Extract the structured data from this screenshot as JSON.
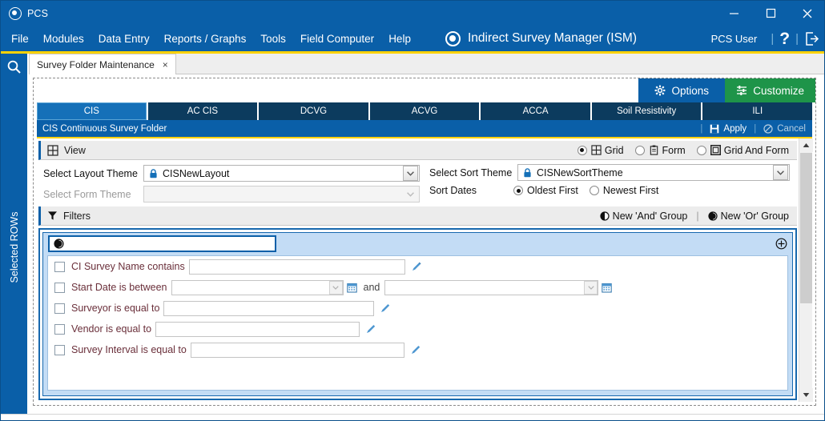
{
  "window": {
    "app_name": "PCS",
    "logo_icon": "pcs-circle-logo",
    "minimize_icon": "minimize-icon",
    "maximize_icon": "maximize-icon",
    "close_icon": "close-icon"
  },
  "menubar": {
    "items": [
      {
        "label": "File"
      },
      {
        "label": "Modules"
      },
      {
        "label": "Data Entry"
      },
      {
        "label": "Reports / Graphs"
      },
      {
        "label": "Tools"
      },
      {
        "label": "Field Computer"
      },
      {
        "label": "Help"
      }
    ],
    "module_title": "Indirect Survey Manager (ISM)",
    "module_icon": "ism-circle-icon",
    "user": "PCS User",
    "help_icon": "question-mark-icon",
    "logout_icon": "logout-icon",
    "separator": "|"
  },
  "doc_tabs": {
    "search_icon": "search-icon",
    "tabs": [
      {
        "label": "Survey Folder Maintenance",
        "close": "×",
        "active": true
      }
    ]
  },
  "sidebar": {
    "vertical_label": "Selected ROWs",
    "grip_icon": "drag-grip-icon"
  },
  "toolbar": {
    "options_label": "Options",
    "options_icon": "gear-icon",
    "customize_label": "Customize",
    "customize_icon": "sliders-icon"
  },
  "category_tabs": [
    {
      "label": "CIS",
      "active": true
    },
    {
      "label": "AC CIS",
      "active": false
    },
    {
      "label": "DCVG",
      "active": false
    },
    {
      "label": "ACVG",
      "active": false
    },
    {
      "label": "ACCA",
      "active": false
    },
    {
      "label": "Soil Resistivity",
      "active": false
    },
    {
      "label": "ILI",
      "active": false
    }
  ],
  "subbar": {
    "title": "CIS Continuous Survey Folder",
    "apply_label": "Apply",
    "apply_icon": "save-disk-icon",
    "cancel_label": "Cancel",
    "cancel_icon": "no-entry-icon",
    "separator": "|"
  },
  "view_section": {
    "title": "View",
    "icon": "grid-icon",
    "modes": [
      {
        "label": "Grid",
        "icon": "grid-icon",
        "selected": true
      },
      {
        "label": "Form",
        "icon": "clipboard-icon",
        "selected": false
      },
      {
        "label": "Grid And Form",
        "icon": "grid-and-form-icon",
        "selected": false
      }
    ]
  },
  "themes": {
    "layout_theme_label": "Select Layout Theme",
    "layout_theme_value": "CISNewLayout",
    "layout_theme_lock_icon": "lock-icon",
    "form_theme_label": "Select Form Theme",
    "form_theme_value": "",
    "sort_theme_label": "Select Sort Theme",
    "sort_theme_value": "CISNewSortTheme",
    "sort_theme_lock_icon": "lock-icon",
    "sort_dates_label": "Sort Dates",
    "sort_dates_options": [
      {
        "label": "Oldest First",
        "selected": true
      },
      {
        "label": "Newest First",
        "selected": false
      }
    ],
    "dropdown_icon": "chevron-down-icon"
  },
  "filters": {
    "title": "Filters",
    "icon": "funnel-icon",
    "new_and_group_label": "New 'And' Group",
    "new_and_group_icon": "half-circle-icon",
    "new_or_group_label": "New 'Or' Group",
    "new_or_group_icon": "half-circle-filled-icon",
    "separator": "|",
    "group": {
      "operator_value": "",
      "operator_icon": "half-circle-icon",
      "add_icon": "plus-circle-icon"
    },
    "conditions": [
      {
        "label": "CI Survey Name contains",
        "value": "",
        "checked": false,
        "type": "text",
        "edit_icon": "pencil-icon"
      },
      {
        "label": "Start Date is between",
        "value": "",
        "value2": "",
        "checked": false,
        "type": "daterange",
        "and_label": "and",
        "dropdown_icon": "chevron-down-icon",
        "calendar_icon": "calendar-icon"
      },
      {
        "label": "Surveyor is equal to",
        "value": "",
        "checked": false,
        "type": "text",
        "edit_icon": "pencil-icon"
      },
      {
        "label": "Vendor is equal to",
        "value": "",
        "checked": false,
        "type": "text",
        "edit_icon": "pencil-icon"
      },
      {
        "label": "Survey Interval is equal to",
        "value": "",
        "checked": false,
        "type": "text",
        "edit_icon": "pencil-icon"
      }
    ]
  },
  "scrollbar": {
    "up_icon": "triangle-up-icon",
    "down_icon": "triangle-down-icon",
    "thumb_position_pct": 0
  },
  "colors": {
    "brand_blue": "#0A5FA8",
    "tab_navy": "#0C3B5E",
    "tab_active": "#1570B8",
    "accent_yellow": "#FFD200",
    "green": "#1E9449",
    "filter_group_bg": "#C3DCF5",
    "condition_label": "#6A2F3A"
  }
}
